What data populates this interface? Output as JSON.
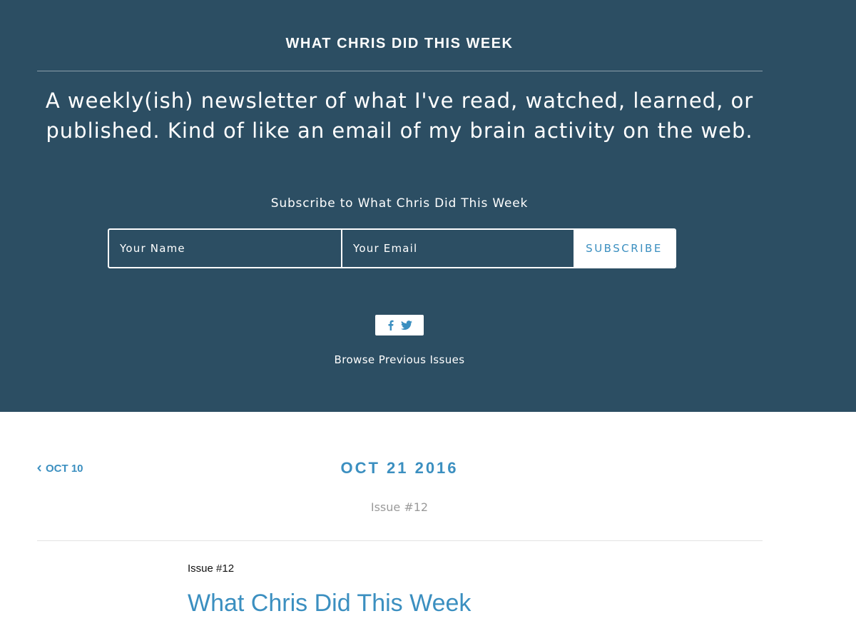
{
  "header": {
    "site_title": "WHAT CHRIS DID THIS WEEK",
    "tagline": "A weekly(ish) newsletter of what I've read, watched, learned, or published. Kind of like an email of my brain activity on the web."
  },
  "subscribe": {
    "heading": "Subscribe to What Chris Did This Week",
    "name_placeholder": "Your Name",
    "email_placeholder": "Your Email",
    "button_label": "SUBSCRIBE"
  },
  "social": {
    "icons": [
      "facebook-icon",
      "twitter-icon"
    ]
  },
  "browse_label": "Browse Previous Issues",
  "issue_nav": {
    "prev_label": "OCT 10",
    "date": "OCT 21 2016",
    "issue_number": "Issue #12"
  },
  "article": {
    "issue_label": "Issue #12",
    "title": "What Chris Did This Week"
  },
  "colors": {
    "hero_bg": "#2c4e63",
    "accent": "#3b8fc0",
    "muted": "#9a9a9a"
  }
}
